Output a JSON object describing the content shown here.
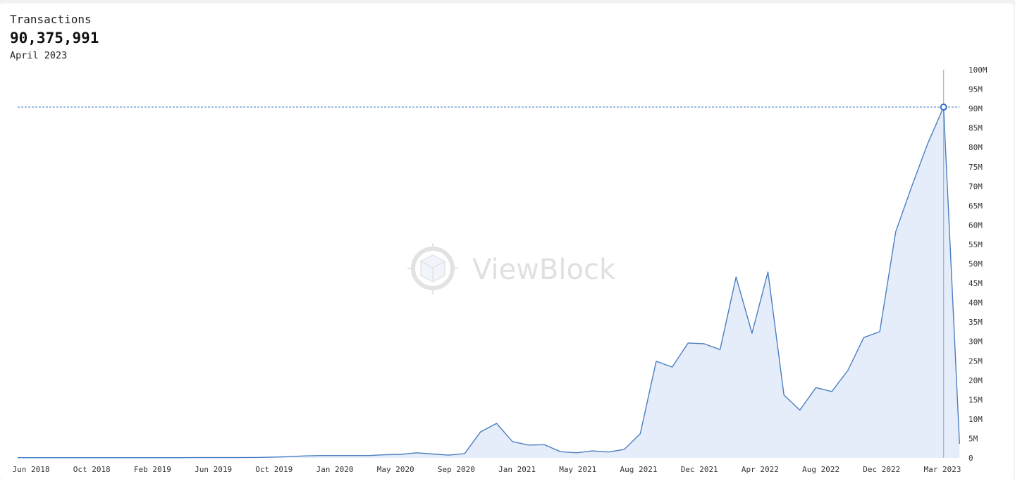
{
  "header": {
    "title": "Transactions",
    "value": "90,375,991",
    "period": "April 2023"
  },
  "watermark": {
    "text": "ViewBlock",
    "icon": "viewblock-cube-logo-icon"
  },
  "colors": {
    "line": "#4a7fc1",
    "area": "#e6edfa",
    "crosshair": "#a8b0bc",
    "guide": "#3c78c8",
    "marker": "#2f6fd1"
  },
  "chart_data": {
    "type": "area",
    "title": "Transactions",
    "xlabel": "",
    "ylabel": "",
    "ylim": [
      0,
      100000000
    ],
    "y_ticks": [
      0,
      5000000,
      10000000,
      15000000,
      20000000,
      25000000,
      30000000,
      35000000,
      40000000,
      45000000,
      50000000,
      55000000,
      60000000,
      65000000,
      70000000,
      75000000,
      80000000,
      85000000,
      90000000,
      95000000,
      100000000
    ],
    "y_tick_labels": [
      "0",
      "5M",
      "10M",
      "15M",
      "20M",
      "25M",
      "30M",
      "35M",
      "40M",
      "45M",
      "50M",
      "55M",
      "60M",
      "65M",
      "70M",
      "75M",
      "80M",
      "85M",
      "90M",
      "95M",
      "100M"
    ],
    "y_axis_position": "right",
    "x_tick_labels": [
      "Jun 2018",
      "Oct 2018",
      "Feb 2019",
      "Jun 2019",
      "Oct 2019",
      "Jan 2020",
      "May 2020",
      "Sep 2020",
      "Jan 2021",
      "May 2021",
      "Aug 2021",
      "Dec 2021",
      "Apr 2022",
      "Aug 2022",
      "Dec 2022",
      "Mar 2023"
    ],
    "grid": false,
    "legend": "none",
    "highlight": {
      "x": "Apr 2023",
      "value": 90375991
    },
    "x": [
      "Jun 2018",
      "Jul 2018",
      "Aug 2018",
      "Sep 2018",
      "Oct 2018",
      "Nov 2018",
      "Dec 2018",
      "Jan 2019",
      "Feb 2019",
      "Mar 2019",
      "Apr 2019",
      "May 2019",
      "Jun 2019",
      "Jul 2019",
      "Aug 2019",
      "Sep 2019",
      "Oct 2019",
      "Nov 2019",
      "Dec 2019",
      "Jan 2020",
      "Feb 2020",
      "Mar 2020",
      "Apr 2020",
      "May 2020",
      "Jun 2020",
      "Jul 2020",
      "Aug 2020",
      "Sep 2020",
      "Oct 2020",
      "Nov 2020",
      "Dec 2020",
      "Jan 2021",
      "Feb 2021",
      "Mar 2021",
      "Apr 2021",
      "May 2021",
      "Jun 2021",
      "Jul 2021",
      "Aug 2021",
      "Sep 2021",
      "Oct 2021",
      "Nov 2021",
      "Dec 2021",
      "Jan 2022",
      "Feb 2022",
      "Mar 2022",
      "Apr 2022",
      "May 2022",
      "Jun 2022",
      "Jul 2022",
      "Aug 2022",
      "Sep 2022",
      "Oct 2022",
      "Nov 2022",
      "Dec 2022",
      "Jan 2023",
      "Feb 2023",
      "Mar 2023",
      "Apr 2023",
      "May 2023"
    ],
    "series": [
      {
        "name": "Transactions",
        "values": [
          50000,
          50000,
          50000,
          50000,
          50000,
          50000,
          50000,
          60000,
          60000,
          60000,
          60000,
          70000,
          70000,
          80000,
          80000,
          100000,
          200000,
          300000,
          500000,
          600000,
          600000,
          600000,
          600000,
          800000,
          900000,
          1300000,
          1000000,
          700000,
          1100000,
          6700000,
          8900000,
          4200000,
          3300000,
          3400000,
          1600000,
          1300000,
          1800000,
          1500000,
          2200000,
          6200000,
          24900000,
          23400000,
          29600000,
          29400000,
          27900000,
          46600000,
          32100000,
          47900000,
          16200000,
          12300000,
          18100000,
          17100000,
          22500000,
          31000000,
          32500000,
          58300000,
          69900000,
          80900000,
          90375991,
          3600000
        ]
      }
    ]
  }
}
